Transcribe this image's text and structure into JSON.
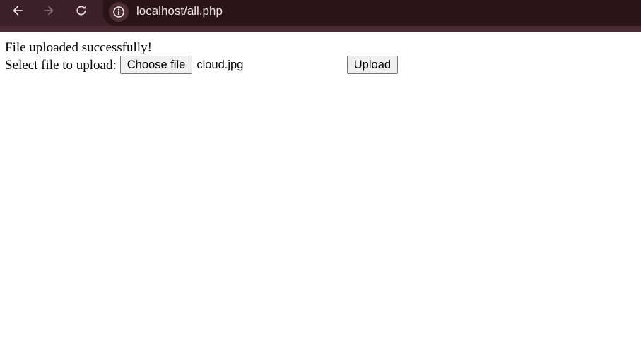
{
  "browser": {
    "url": "localhost/all.php",
    "icons": {
      "back": "arrow-left-icon",
      "forward": "arrow-right-icon",
      "reload": "reload-icon",
      "site_info": "info-icon"
    },
    "colors": {
      "toolbar": "#3c1f28",
      "address_bar": "#2a1319"
    }
  },
  "page": {
    "message": "File uploaded successfully!",
    "form": {
      "label": "Select file to upload:",
      "choose_file_label": "Choose file",
      "selected_file": "cloud.jpg",
      "submit_label": "Upload"
    }
  }
}
